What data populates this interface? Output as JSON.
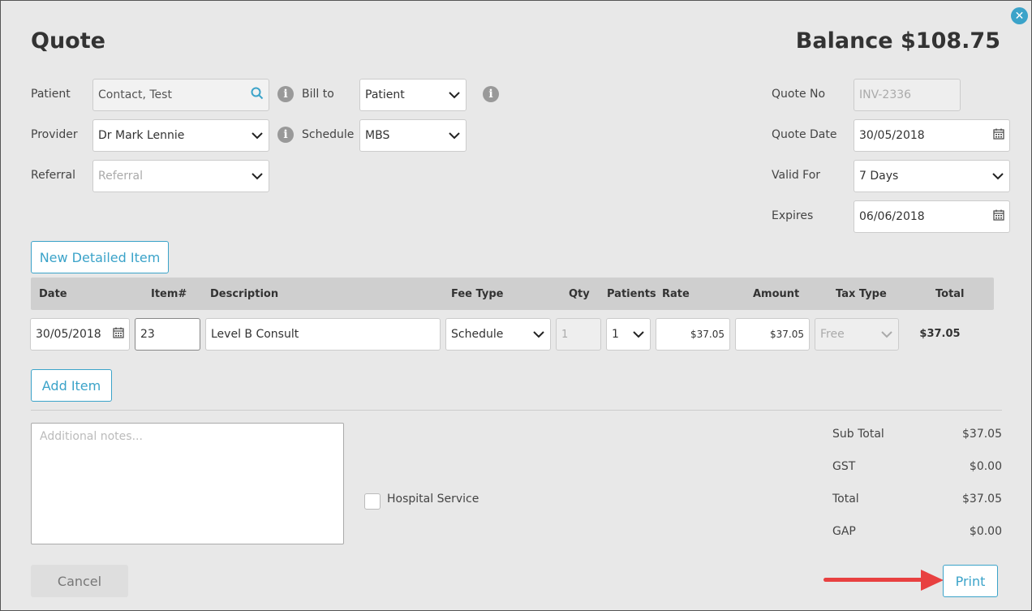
{
  "header": {
    "title": "Quote",
    "balance": "Balance $108.75"
  },
  "patient": {
    "label": "Patient",
    "value": "Contact, Test"
  },
  "bill_to": {
    "label": "Bill to",
    "value": "Patient"
  },
  "provider": {
    "label": "Provider",
    "value": "Dr Mark Lennie"
  },
  "schedule": {
    "label": "Schedule",
    "value": "MBS"
  },
  "referral": {
    "label": "Referral",
    "placeholder": "Referral"
  },
  "quote_no": {
    "label": "Quote No",
    "value": "INV-2336"
  },
  "quote_date": {
    "label": "Quote Date",
    "value": "30/05/2018"
  },
  "valid_for": {
    "label": "Valid For",
    "value": "7 Days"
  },
  "expires": {
    "label": "Expires",
    "value": "06/06/2018"
  },
  "new_detailed_item_label": "New Detailed Item",
  "grid": {
    "columns": [
      "Date",
      "Item#",
      "Description",
      "Fee Type",
      "Qty",
      "Patients",
      "Rate",
      "Amount",
      "Tax Type",
      "Total"
    ],
    "row": {
      "date": "30/05/2018",
      "item": "23",
      "description": "Level B Consult",
      "fee_type": "Schedule",
      "qty": "1",
      "patients": "1",
      "rate": "$37.05",
      "amount": "$37.05",
      "tax_type": "Free",
      "total": "$37.05"
    }
  },
  "add_item_label": "Add Item",
  "notes_placeholder": "Additional notes...",
  "hospital_service_label": "Hospital Service",
  "totals": {
    "sub_total_label": "Sub Total",
    "sub_total": "$37.05",
    "gst_label": "GST",
    "gst": "$0.00",
    "total_label": "Total",
    "total": "$37.05",
    "gap_label": "GAP",
    "gap": "$0.00"
  },
  "footer": {
    "cancel_label": "Cancel",
    "print_label": "Print"
  },
  "colors": {
    "accent": "#3ba3c9",
    "arrow": "#e84040",
    "header_bg": "#cfcfcf"
  },
  "icons": [
    "close-icon",
    "search-icon",
    "info-icon",
    "chevron-down-icon",
    "calendar-icon",
    "arrow-right-icon"
  ]
}
